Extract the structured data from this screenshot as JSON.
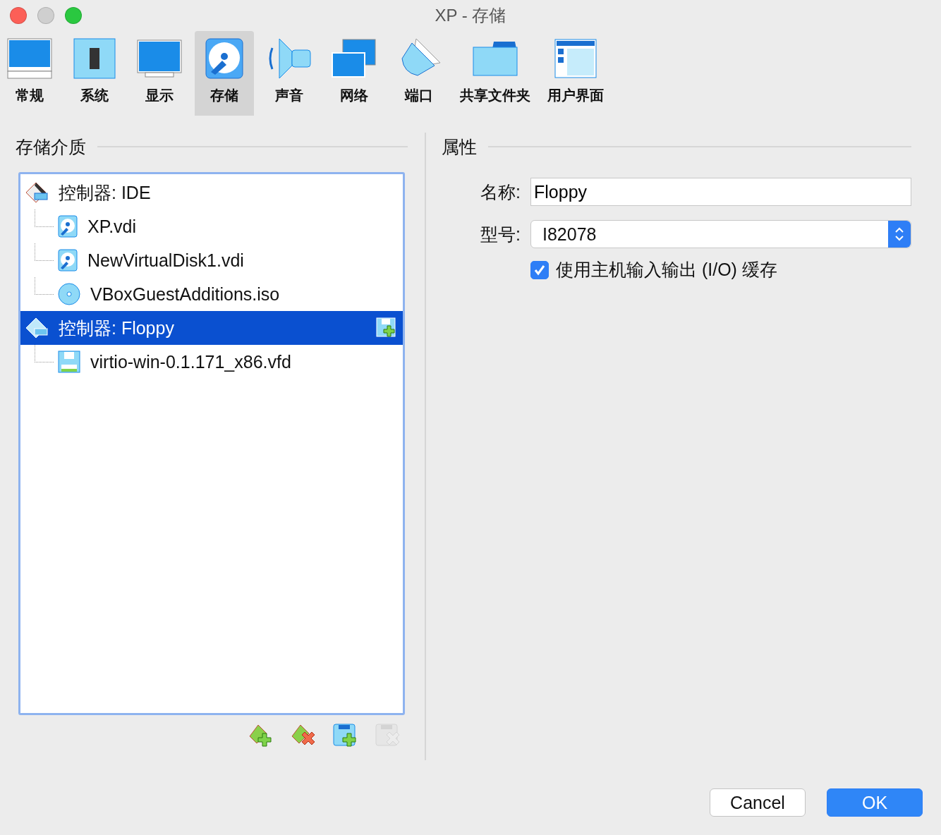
{
  "window": {
    "title": "XP - 存储"
  },
  "tabs": [
    {
      "label": "常规",
      "kind": "general",
      "selected": false
    },
    {
      "label": "系统",
      "kind": "system",
      "selected": false
    },
    {
      "label": "显示",
      "kind": "display",
      "selected": false
    },
    {
      "label": "存储",
      "kind": "storage",
      "selected": true
    },
    {
      "label": "声音",
      "kind": "audio",
      "selected": false
    },
    {
      "label": "网络",
      "kind": "network",
      "selected": false
    },
    {
      "label": "端口",
      "kind": "ports",
      "selected": false
    },
    {
      "label": "共享文件夹",
      "kind": "shared",
      "selected": false
    },
    {
      "label": "用户界面",
      "kind": "ui",
      "selected": false
    }
  ],
  "storage": {
    "heading": "存储介质",
    "tree": [
      {
        "label": "控制器: IDE",
        "kind": "ide",
        "selected": false,
        "children": [
          {
            "label": "XP.vdi",
            "kind": "hdd",
            "selected": false
          },
          {
            "label": "NewVirtualDisk1.vdi",
            "kind": "hdd",
            "selected": false
          },
          {
            "label": "VBoxGuestAdditions.iso",
            "kind": "cd",
            "selected": false
          }
        ]
      },
      {
        "label": "控制器: Floppy",
        "kind": "floppy-controller",
        "selected": true,
        "children": [
          {
            "label": "virtio-win-0.1.171_x86.vfd",
            "kind": "floppy",
            "selected": false
          }
        ]
      }
    ],
    "actions": [
      {
        "kind": "add-controller",
        "disabled": false
      },
      {
        "kind": "remove-controller",
        "disabled": false
      },
      {
        "kind": "add-attachment",
        "disabled": false
      },
      {
        "kind": "remove-attachment",
        "disabled": true
      }
    ]
  },
  "attributes": {
    "heading": "属性",
    "name_label": "名称:",
    "name_value": "Floppy",
    "type_label": "型号:",
    "type_value": "I82078",
    "cache": {
      "label": "使用主机输入输出 (I/O) 缓存",
      "checked": true
    }
  },
  "buttons": [
    {
      "label": "Cancel",
      "kind": "default"
    },
    {
      "label": "OK",
      "kind": "primary"
    }
  ]
}
